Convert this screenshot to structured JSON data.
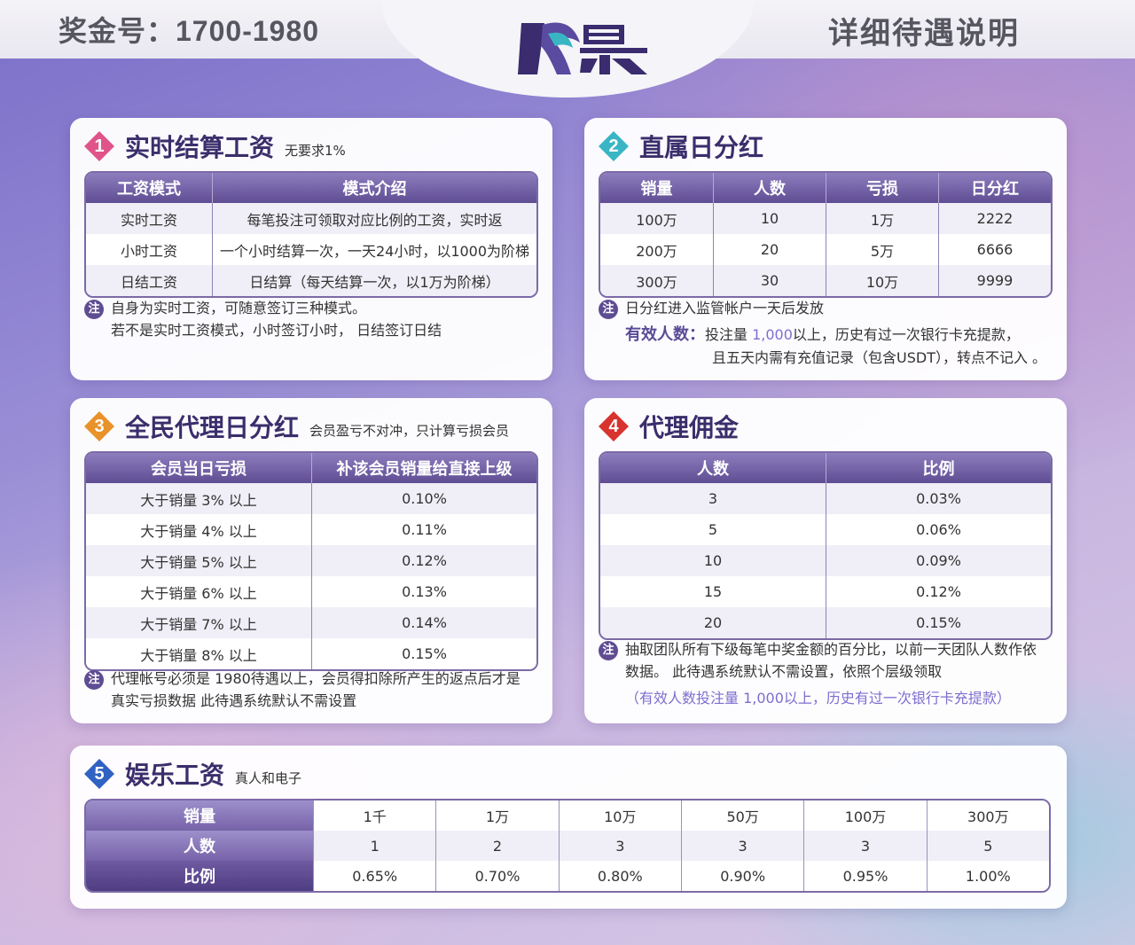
{
  "header": {
    "bonus_label": "奖金号：1700-1980",
    "detail_title": "详细待遇说明",
    "logo_alt": "logo"
  },
  "colors": {
    "brand_purple": "#3b2e6b",
    "table_header": "#6f5ea4",
    "badge1": "#e0548a",
    "badge2": "#39b5c4",
    "badge3": "#e8922a",
    "badge4": "#d8332f",
    "badge5": "#2f62c2"
  },
  "realtime_salary": {
    "badge": "1",
    "title": "实时结算工资",
    "subtitle": "无要求1%",
    "headers": [
      "工资模式",
      "模式介绍"
    ],
    "rows": [
      [
        "实时工资",
        "每笔投注可领取对应比例的工资，实时返"
      ],
      [
        "小时工资",
        "一个小时结算一次，一天24小时，以1000为阶梯"
      ],
      [
        "日结工资",
        "日结算（每天结算一次，以1万为阶梯）"
      ]
    ],
    "note_icon": "注",
    "note_line1": "自身为实时工资，可随意签订三种模式。",
    "note_line2": "若不是实时工资模式，小时签订小时， 日结签订日结"
  },
  "direct_dividend": {
    "badge": "2",
    "title": "直属日分红",
    "headers": [
      "销量",
      "人数",
      "亏损",
      "日分红"
    ],
    "rows": [
      [
        "100万",
        "10",
        "1万",
        "2222"
      ],
      [
        "200万",
        "20",
        "5万",
        "6666"
      ],
      [
        "300万",
        "30",
        "10万",
        "9999"
      ]
    ],
    "note_icon": "注",
    "note_line1": "日分红进入监管帐户一天后发放",
    "valid_label": "有效人数：",
    "valid_pre": "投注量 ",
    "valid_amount": "1,000",
    "valid_post": "以上，历史有过一次银行卡充提款，",
    "valid_line2": "且五天内需有充值记录（包含USDT），转点不记入 。"
  },
  "agent_dividend": {
    "badge": "3",
    "title": "全民代理日分红",
    "subtitle": "会员盈亏不对冲，只计算亏损会员",
    "headers": [
      "会员当日亏损",
      "补该会员销量给直接上级"
    ],
    "rows": [
      [
        "大于销量 3% 以上",
        "0.10%"
      ],
      [
        "大于销量 4% 以上",
        "0.11%"
      ],
      [
        "大于销量 5% 以上",
        "0.12%"
      ],
      [
        "大于销量 6% 以上",
        "0.13%"
      ],
      [
        "大于销量 7% 以上",
        "0.14%"
      ],
      [
        "大于销量 8% 以上",
        "0.15%"
      ]
    ],
    "note_icon": "注",
    "note_line1": "代理帐号必须是 1980待遇以上，会员得扣除所产生的返点后才是",
    "note_line2": "真实亏损数据 此待遇系统默认不需设置"
  },
  "agent_commission": {
    "badge": "4",
    "title": "代理佣金",
    "headers": [
      "人数",
      "比例"
    ],
    "rows": [
      [
        "3",
        "0.03%"
      ],
      [
        "5",
        "0.06%"
      ],
      [
        "10",
        "0.09%"
      ],
      [
        "15",
        "0.12%"
      ],
      [
        "20",
        "0.15%"
      ]
    ],
    "note_icon": "注",
    "note_line1": "抽取团队所有下级每笔中奖金额的百分比，以前一天团队人数作依",
    "note_line2": "数据。 此待遇系统默认不需设置，依照个层级领取",
    "note_line3": "（有效人数投注量 1,000以上，历史有过一次银行卡充提款）"
  },
  "entertainment": {
    "badge": "5",
    "title": "娱乐工资",
    "subtitle": "真人和电子",
    "row_labels": [
      "销量",
      "人数",
      "比例"
    ],
    "sales": [
      "1千",
      "1万",
      "10万",
      "50万",
      "100万",
      "300万"
    ],
    "people": [
      "1",
      "2",
      "3",
      "3",
      "3",
      "5"
    ],
    "ratios": [
      "0.65%",
      "0.70%",
      "0.80%",
      "0.90%",
      "0.95%",
      "1.00%"
    ]
  }
}
